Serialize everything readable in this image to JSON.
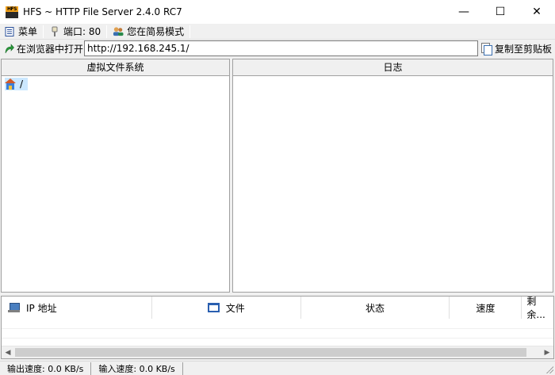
{
  "window": {
    "title": "HFS ~ HTTP File Server 2.4.0 RC7",
    "icon_text": "HFS",
    "minimize_glyph": "—",
    "maximize_glyph": "☐",
    "close_glyph": "✕"
  },
  "menubar": {
    "menu_label": "菜单",
    "port_label": "端口: 80",
    "mode_label": "您在简易模式"
  },
  "urlbar": {
    "open_label": "在浏览器中打开",
    "url_value": "http://192.168.245.1/",
    "copy_label": "复制至剪贴板"
  },
  "vfs": {
    "header": "虚拟文件系统",
    "root_label": "/"
  },
  "log": {
    "header": "日志"
  },
  "connections": {
    "columns": [
      "IP 地址",
      "文件",
      "状态",
      "速度",
      "剩余..."
    ]
  },
  "statusbar": {
    "out_speed": "输出速度: 0.0 KB/s",
    "in_speed": "输入速度: 0.0 KB/s"
  },
  "icons": {
    "menu": "menu-icon",
    "port": "port-plug-icon",
    "mode": "users-icon",
    "open": "open-browser-arrow-icon",
    "copy": "copy-icon",
    "root": "home-folder-icon",
    "ip": "computer-icon",
    "file": "window-file-icon"
  }
}
